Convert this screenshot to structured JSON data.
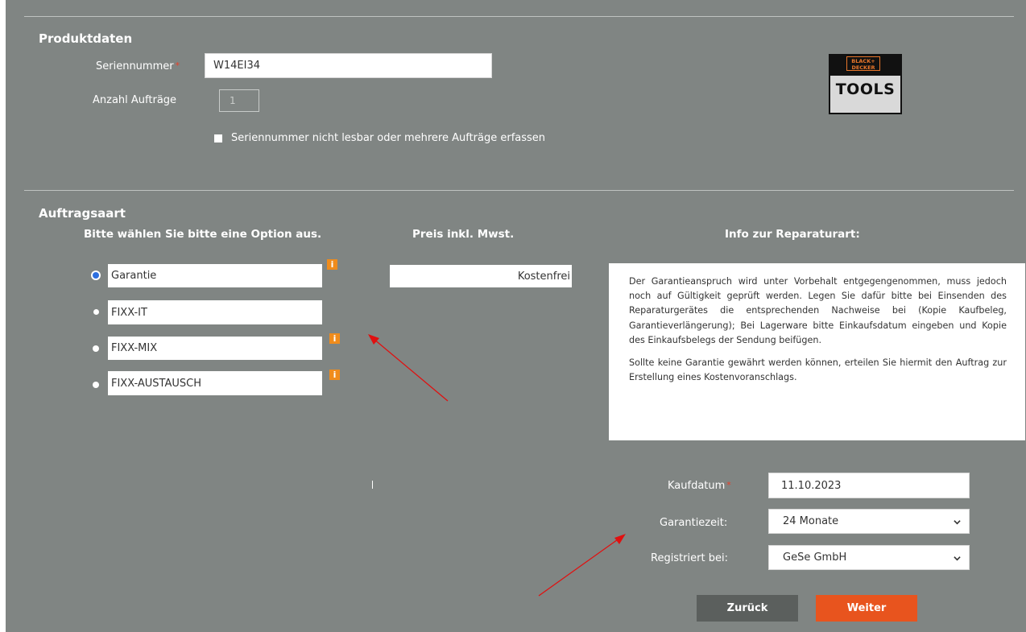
{
  "product": {
    "title": "Produktdaten",
    "serial_label": "Seriennummer",
    "serial_required_mark": "*",
    "serial_value": "W14EI34",
    "orders_label": "Anzahl Aufträge",
    "orders_value": "1",
    "checkbox_label": "Seriennummer nicht lesbar oder mehrere Aufträge erfassen",
    "logo_top": "BLACK+ DECKER",
    "logo_bottom": "TOOLS"
  },
  "order": {
    "title": "Auftragsaart",
    "options_heading": "Bitte wählen Sie bitte eine Option aus.",
    "price_heading": "Preis inkl. Mwst.",
    "info_heading": "Info zur Reparaturart:",
    "options": [
      {
        "label": "Garantie",
        "selected": true,
        "has_info": true
      },
      {
        "label": "FIXX-IT",
        "selected": false,
        "has_info": false
      },
      {
        "label": "FIXX-MIX",
        "selected": false,
        "has_info": true
      },
      {
        "label": "FIXX-AUSTAUSCH",
        "selected": false,
        "has_info": true
      }
    ],
    "info_glyph": "i",
    "price_value": "Kostenfrei",
    "info_paragraphs": [
      "Der Garantieanspruch wird unter Vorbehalt entgegengenommen, muss jedoch noch auf Gültigkeit geprüft werden. Legen Sie dafür bitte bei Einsenden des Reparaturgerätes die entsprechenden Nachweise bei (Kopie Kaufbeleg, Garantieverlängerung); Bei Lagerware bitte Einkaufsdatum eingeben und Kopie des Einkaufsbelegs der Sendung beifügen.",
      "Sollte keine Garantie gewährt werden können, erteilen Sie hiermit den Auftrag zur Erstellung eines Kostenvoranschlags."
    ]
  },
  "purchase": {
    "date_label": "Kaufdatum",
    "date_required_mark": "*",
    "date_value": "11.10.2023",
    "warranty_label": "Garantiezeit:",
    "warranty_value": "24 Monate",
    "registered_label": "Registriert bei:",
    "registered_value": "GeSe GmbH"
  },
  "buttons": {
    "back": "Zurück",
    "next": "Weiter"
  },
  "colors": {
    "panel_bg": "#808583",
    "accent": "#e8541e",
    "back_button": "#5b5f5d",
    "info_icon": "#f08c1c",
    "radio_selected": "#2d6fe0",
    "annotation_arrow": "#e01010"
  },
  "icons": {
    "info": "info-icon",
    "dropdown": "chevron-down-icon",
    "annotation": "arrow-icon"
  }
}
